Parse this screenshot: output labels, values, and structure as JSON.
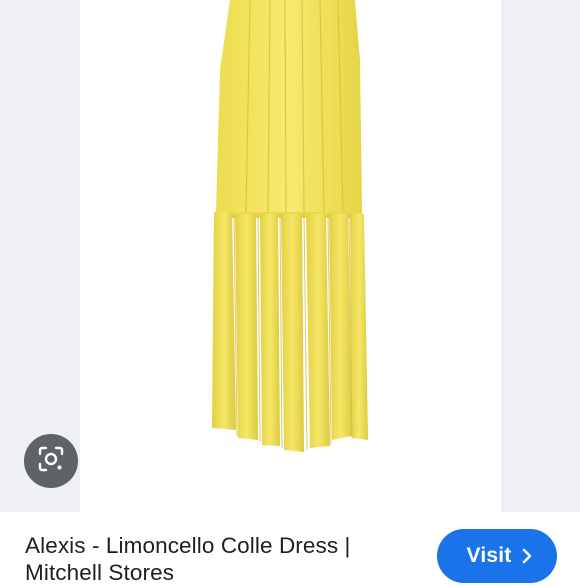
{
  "product": {
    "title": "Alexis - Limoncello Colle Dress | Mitchell Stores",
    "image_subject": "yellow-fringe-dress"
  },
  "actions": {
    "visit_label": "Visit",
    "visit_icon": "chevron-right-icon",
    "lens_icon": "lens-search-icon"
  },
  "colors": {
    "dress": "#f2e25a",
    "dress_shadow": "#d9c63c",
    "button_blue": "#1a73e8",
    "lens_button": "#5f6368",
    "side_panel": "#eef0f3"
  }
}
